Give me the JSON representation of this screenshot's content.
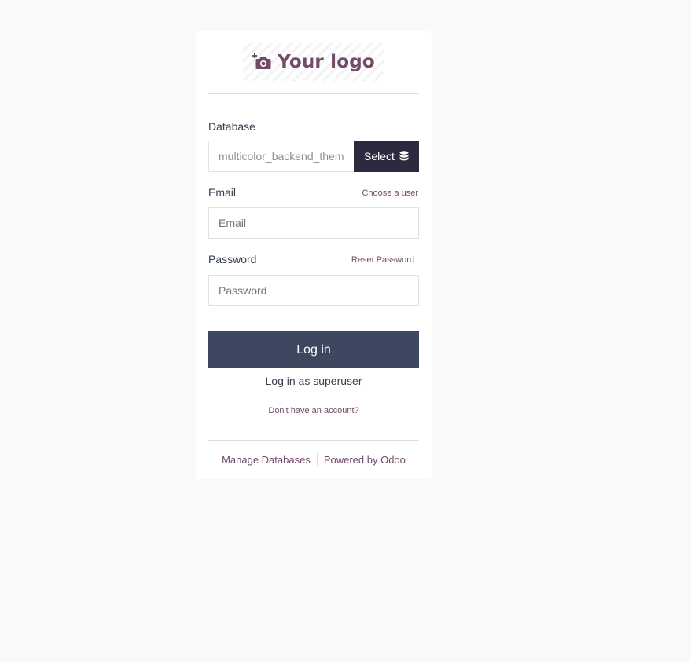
{
  "logo": {
    "text": "Your logo",
    "icon": "camera-plus-icon",
    "color": "#714B67"
  },
  "database": {
    "label": "Database",
    "value": "multicolor_backend_them",
    "select_label": "Select",
    "select_icon": "database-icon"
  },
  "email": {
    "label": "Email",
    "placeholder": "Email",
    "helper_link": "Choose a user"
  },
  "password": {
    "label": "Password",
    "placeholder": "Password",
    "helper_link": "Reset Password"
  },
  "login_button": "Log in",
  "superuser_link": "Log in as superuser",
  "signup_link": "Don't have an account?",
  "footer": {
    "manage_databases": "Manage Databases",
    "powered_by": "Powered by Odoo"
  },
  "colors": {
    "accent": "#714B67",
    "primary_button": "#3d4760",
    "select_button": "#2b2a3e",
    "background": "#f8f9fb"
  }
}
